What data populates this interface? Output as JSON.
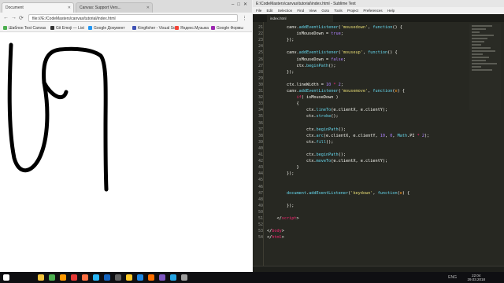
{
  "browser": {
    "tabs": [
      {
        "label": "Document"
      },
      {
        "label": "Canvas: Support Vers..."
      }
    ],
    "address": "file:///E:/CodeMasters/canvas/tutorial/index.html",
    "bookmarks": [
      {
        "label": "Шаблон Test Canvas",
        "color": "#4caf50"
      },
      {
        "label": "Git Emoji — List",
        "color": "#333333"
      },
      {
        "label": "Google Документ",
        "color": "#2196f3"
      },
      {
        "label": "Kingfisher - Visual So",
        "color": "#3f51b5"
      },
      {
        "label": "Яндекс.Музыка",
        "color": "#f44336"
      },
      {
        "label": "Google Формы",
        "color": "#9c27b0"
      },
      {
        "label": "MediaFire",
        "color": "#1e88e5"
      }
    ]
  },
  "editor": {
    "window_title": "E:\\CodeMasters\\canvas\\tutorial\\index.html - Sublime Text",
    "menu": [
      "File",
      "Edit",
      "Selection",
      "Find",
      "View",
      "Goto",
      "Tools",
      "Project",
      "Preferences",
      "Help"
    ],
    "tab_label": "index.html",
    "line_numbers": [
      "21",
      "22",
      "23",
      "24",
      "25",
      "26",
      "27",
      "28",
      "29",
      "30",
      "31",
      "32",
      "33",
      "34",
      "35",
      "36",
      "37",
      "38",
      "39",
      "40",
      "41",
      "42",
      "43",
      "44",
      "45",
      "46",
      "47",
      "48",
      "49",
      "50",
      "51",
      "52",
      "53",
      "54"
    ],
    "code_lines": [
      {
        "indent": "        ",
        "segments": [
          {
            "t": "canv.",
            "c": "#f8f8f2"
          },
          {
            "t": "addEventListener",
            "c": "#66d9ef"
          },
          {
            "t": "(",
            "c": "#f8f8f2"
          },
          {
            "t": "'mousedown'",
            "c": "#e6db74"
          },
          {
            "t": ", ",
            "c": "#f8f8f2"
          },
          {
            "t": "function",
            "c": "#66d9ef"
          },
          {
            "t": "() {",
            "c": "#f8f8f2"
          }
        ]
      },
      {
        "indent": "            ",
        "segments": [
          {
            "t": "isMouseDown = ",
            "c": "#f8f8f2"
          },
          {
            "t": "true",
            "c": "#ae81ff"
          },
          {
            "t": ";",
            "c": "#f8f8f2"
          }
        ]
      },
      {
        "indent": "        ",
        "segments": [
          {
            "t": "});",
            "c": "#f8f8f2"
          }
        ]
      },
      {
        "indent": "",
        "segments": []
      },
      {
        "indent": "        ",
        "segments": [
          {
            "t": "canv.",
            "c": "#f8f8f2"
          },
          {
            "t": "addEventListener",
            "c": "#66d9ef"
          },
          {
            "t": "(",
            "c": "#f8f8f2"
          },
          {
            "t": "'mouseup'",
            "c": "#e6db74"
          },
          {
            "t": ", ",
            "c": "#f8f8f2"
          },
          {
            "t": "function",
            "c": "#66d9ef"
          },
          {
            "t": "() {",
            "c": "#f8f8f2"
          }
        ]
      },
      {
        "indent": "            ",
        "segments": [
          {
            "t": "isMouseDown = ",
            "c": "#f8f8f2"
          },
          {
            "t": "false",
            "c": "#ae81ff"
          },
          {
            "t": ";",
            "c": "#f8f8f2"
          }
        ]
      },
      {
        "indent": "            ",
        "segments": [
          {
            "t": "ctx.",
            "c": "#f8f8f2"
          },
          {
            "t": "beginPath",
            "c": "#66d9ef"
          },
          {
            "t": "();",
            "c": "#f8f8f2"
          }
        ]
      },
      {
        "indent": "        ",
        "segments": [
          {
            "t": "});",
            "c": "#f8f8f2"
          }
        ]
      },
      {
        "indent": "",
        "segments": []
      },
      {
        "indent": "        ",
        "segments": [
          {
            "t": "ctx.lineWidth = ",
            "c": "#f8f8f2"
          },
          {
            "t": "10",
            "c": "#ae81ff"
          },
          {
            "t": " * ",
            "c": "#f92672"
          },
          {
            "t": "2",
            "c": "#ae81ff"
          },
          {
            "t": ";",
            "c": "#f8f8f2"
          }
        ]
      },
      {
        "indent": "        ",
        "segments": [
          {
            "t": "canv.",
            "c": "#f8f8f2"
          },
          {
            "t": "addEventListener",
            "c": "#66d9ef"
          },
          {
            "t": "(",
            "c": "#f8f8f2"
          },
          {
            "t": "'mousemove'",
            "c": "#e6db74"
          },
          {
            "t": ", ",
            "c": "#f8f8f2"
          },
          {
            "t": "function",
            "c": "#66d9ef"
          },
          {
            "t": "(",
            "c": "#f8f8f2"
          },
          {
            "t": "e",
            "c": "#fd971f"
          },
          {
            "t": ") {",
            "c": "#f8f8f2"
          }
        ]
      },
      {
        "indent": "            ",
        "segments": [
          {
            "t": "if",
            "c": "#f92672"
          },
          {
            "t": "( isMouseDown )",
            "c": "#f8f8f2"
          }
        ]
      },
      {
        "indent": "            ",
        "segments": [
          {
            "t": "{",
            "c": "#f8f8f2"
          }
        ]
      },
      {
        "indent": "                ",
        "segments": [
          {
            "t": "ctx.",
            "c": "#f8f8f2"
          },
          {
            "t": "lineTo",
            "c": "#66d9ef"
          },
          {
            "t": "(e.clientX, e.clientY);",
            "c": "#f8f8f2"
          }
        ]
      },
      {
        "indent": "                ",
        "segments": [
          {
            "t": "ctx.",
            "c": "#f8f8f2"
          },
          {
            "t": "stroke",
            "c": "#66d9ef"
          },
          {
            "t": "();",
            "c": "#f8f8f2"
          }
        ]
      },
      {
        "indent": "",
        "segments": []
      },
      {
        "indent": "                ",
        "segments": [
          {
            "t": "ctx.",
            "c": "#f8f8f2"
          },
          {
            "t": "beginPath",
            "c": "#66d9ef"
          },
          {
            "t": "();",
            "c": "#f8f8f2"
          }
        ]
      },
      {
        "indent": "                ",
        "segments": [
          {
            "t": "ctx.",
            "c": "#f8f8f2"
          },
          {
            "t": "arc",
            "c": "#66d9ef"
          },
          {
            "t": "(e.clientX, e.clientY, ",
            "c": "#f8f8f2"
          },
          {
            "t": "10",
            "c": "#ae81ff"
          },
          {
            "t": ", ",
            "c": "#f8f8f2"
          },
          {
            "t": "0",
            "c": "#ae81ff"
          },
          {
            "t": ", ",
            "c": "#f8f8f2"
          },
          {
            "t": "Math",
            "c": "#66d9ef"
          },
          {
            "t": ".PI",
            "c": "#f8f8f2"
          },
          {
            "t": " * ",
            "c": "#f92672"
          },
          {
            "t": "2",
            "c": "#ae81ff"
          },
          {
            "t": ");",
            "c": "#f8f8f2"
          }
        ]
      },
      {
        "indent": "                ",
        "segments": [
          {
            "t": "ctx.",
            "c": "#f8f8f2"
          },
          {
            "t": "fill",
            "c": "#66d9ef"
          },
          {
            "t": "();",
            "c": "#f8f8f2"
          }
        ]
      },
      {
        "indent": "",
        "segments": []
      },
      {
        "indent": "                ",
        "segments": [
          {
            "t": "ctx.",
            "c": "#f8f8f2"
          },
          {
            "t": "beginPath",
            "c": "#66d9ef"
          },
          {
            "t": "();",
            "c": "#f8f8f2"
          }
        ]
      },
      {
        "indent": "                ",
        "segments": [
          {
            "t": "ctx.",
            "c": "#f8f8f2"
          },
          {
            "t": "moveTo",
            "c": "#66d9ef"
          },
          {
            "t": "(e.clientX, e.clientY);",
            "c": "#f8f8f2"
          }
        ]
      },
      {
        "indent": "            ",
        "segments": [
          {
            "t": "}",
            "c": "#f8f8f2"
          }
        ]
      },
      {
        "indent": "        ",
        "segments": [
          {
            "t": "});",
            "c": "#f8f8f2"
          }
        ]
      },
      {
        "indent": "",
        "segments": []
      },
      {
        "indent": "",
        "segments": []
      },
      {
        "indent": "        ",
        "segments": [
          {
            "t": "document",
            "c": "#66d9ef"
          },
          {
            "t": ".",
            "c": "#f8f8f2"
          },
          {
            "t": "addEventListener",
            "c": "#66d9ef"
          },
          {
            "t": "(",
            "c": "#f8f8f2"
          },
          {
            "t": "'keydown'",
            "c": "#e6db74"
          },
          {
            "t": ", ",
            "c": "#f8f8f2"
          },
          {
            "t": "function",
            "c": "#66d9ef"
          },
          {
            "t": "(",
            "c": "#f8f8f2"
          },
          {
            "t": "e",
            "c": "#fd971f"
          },
          {
            "t": ") {",
            "c": "#f8f8f2"
          }
        ]
      },
      {
        "indent": "",
        "segments": []
      },
      {
        "indent": "        ",
        "segments": [
          {
            "t": "});",
            "c": "#f8f8f2"
          }
        ]
      },
      {
        "indent": "",
        "segments": []
      },
      {
        "indent": "    ",
        "segments": [
          {
            "t": "</",
            "c": "#f8f8f2"
          },
          {
            "t": "script",
            "c": "#f92672"
          },
          {
            "t": ">",
            "c": "#f8f8f2"
          }
        ]
      },
      {
        "indent": "",
        "segments": []
      },
      {
        "indent": "",
        "segments": [
          {
            "t": "</",
            "c": "#f8f8f2"
          },
          {
            "t": "body",
            "c": "#f92672"
          },
          {
            "t": ">",
            "c": "#f8f8f2"
          }
        ]
      },
      {
        "indent": "",
        "segments": [
          {
            "t": "</",
            "c": "#f8f8f2"
          },
          {
            "t": "html",
            "c": "#f92672"
          },
          {
            "t": ">",
            "c": "#f8f8f2"
          }
        ]
      }
    ]
  },
  "taskbar": {
    "clock_time": "22:04",
    "clock_date": "29.03.2018",
    "tray_lang": "ENG",
    "icons": [
      {
        "name": "windows-start-icon",
        "color": "#ffffff"
      },
      {
        "name": "file-explorer-icon",
        "color": "#f3c33c"
      },
      {
        "name": "chrome-icon",
        "color": "#4caf50"
      },
      {
        "name": "sublime-text-icon",
        "color": "#ff9800"
      },
      {
        "name": "opera-icon",
        "color": "#e53935"
      },
      {
        "name": "firefox-icon",
        "color": "#ff7043"
      },
      {
        "name": "skype-icon",
        "color": "#29b6f6"
      },
      {
        "name": "photoshop-icon",
        "color": "#1565c0"
      },
      {
        "name": "terminal-icon",
        "color": "#616161"
      },
      {
        "name": "folder-icon",
        "color": "#ffca28"
      },
      {
        "name": "vscode-icon",
        "color": "#1e88e5"
      },
      {
        "name": "illustrator-icon",
        "color": "#ff6f00"
      },
      {
        "name": "media-player-icon",
        "color": "#7e57c2"
      },
      {
        "name": "telegram-icon",
        "color": "#26a5e4"
      },
      {
        "name": "mail-icon",
        "color": "#9e9e9e"
      }
    ]
  }
}
